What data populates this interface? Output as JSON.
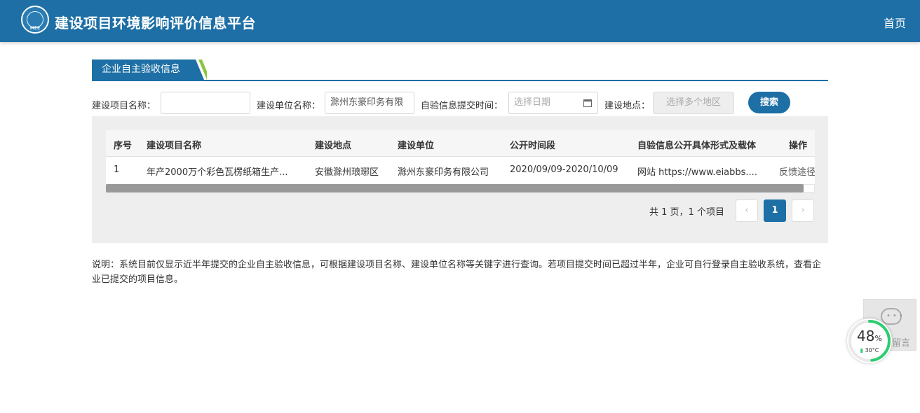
{
  "header": {
    "logo_text": "MEE",
    "title": "建设项目环境影响评价信息平台",
    "nav_home": "首页"
  },
  "section": {
    "title": "企业自主验收信息"
  },
  "filters": {
    "project_name_label": "建设项目名称：",
    "project_name_value": "",
    "unit_name_label": "建设单位名称：",
    "unit_name_value": "滁州东豪印务有限",
    "submit_time_label": "自验信息提交时间：",
    "submit_time_placeholder": "选择日期",
    "location_label": "建设地点：",
    "location_placeholder": "选择多个地区",
    "search_button": "搜索"
  },
  "table": {
    "columns": [
      "序号",
      "建设项目名称",
      "建设地点",
      "建设单位",
      "公开时间段",
      "自验信息公开具体形式及载体",
      "操作"
    ],
    "rows": [
      [
        "1",
        "年产2000万个彩色瓦楞纸箱生产...",
        "安徽滁州琅琊区",
        "滁州东豪印务有限公司",
        "2020/09/09-2020/10/09",
        "网站 https://www.eiabbs....",
        "反馈途径"
      ]
    ]
  },
  "pagination": {
    "info": "共 1 页，1 个项目",
    "prev": "‹",
    "current": "1",
    "next": "›"
  },
  "note": "说明：系统目前仅显示近半年提交的企业自主验收信息，可根据建设项目名称、建设单位名称等关键字进行查询。若项目提交时间已超过半年，企业可自行登录自主验收系统，查看企业已提交的项目信息。",
  "message_widget": {
    "label": "留言",
    "icon": "chat-bubble-icon"
  },
  "gauge": {
    "value": "48",
    "unit": "%",
    "temperature": "30°C",
    "fraction": 0.48,
    "color": "#2ecc71"
  }
}
